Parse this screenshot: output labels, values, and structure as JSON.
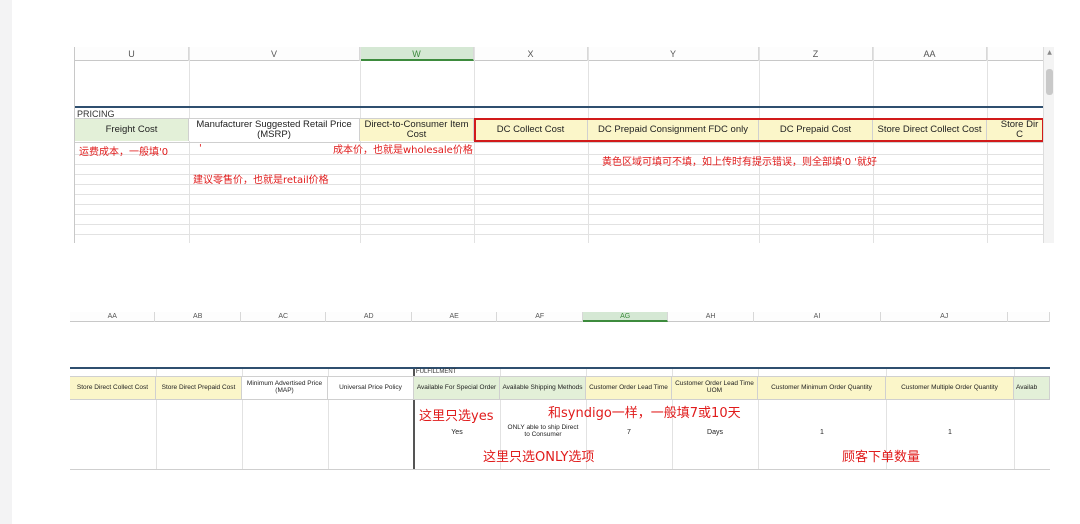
{
  "sheet_top": {
    "columns": [
      "U",
      "V",
      "W",
      "X",
      "Y",
      "Z",
      "AA"
    ],
    "selected_column": "W",
    "section_label": "PRICING",
    "headers": [
      "Freight Cost",
      "Manufacturer Suggested Retail Price (MSRP)",
      "Direct-to-Consumer Item Cost",
      "DC Collect Cost",
      "DC Prepaid Consignment FDC only",
      "DC Prepaid Cost",
      "Store Direct Collect Cost",
      "Store Dir C"
    ],
    "notes": {
      "freight": "运费成本，一般填'0",
      "tick": "'",
      "cost_price": "成本价，也就是wholesale价格",
      "yellow_area": "黄色区域可填可不填，如上传时有提示错误，则全部填'0 '就好",
      "retail": "建议零售价，也就是retail价格"
    }
  },
  "sheet_bottom": {
    "columns": [
      "AA",
      "AB",
      "AC",
      "AD",
      "AE",
      "AF",
      "AG",
      "AH",
      "AI",
      "AJ"
    ],
    "selected_column": "AG",
    "section_label": "FULFILLMENT",
    "headers": [
      "Store Direct Collect Cost",
      "Store Direct Prepaid Cost",
      "Minimum Advertised Price (MAP)",
      "Universal Price Policy",
      "Available For Special Order",
      "Available Shipping Methods",
      "Customer Order Lead Time",
      "Customer Order Lead Time UOM",
      "Customer Minimum Order Quantity",
      "Customer Multiple Order Quantity",
      "Availab"
    ],
    "values": {
      "special_order": "Yes",
      "shipping": "ONLY able to ship Direct to Consumer",
      "lead_time": "7",
      "lead_uom": "Days",
      "min_qty": "1",
      "multiple_qty": "1"
    },
    "notes": {
      "only_yes": "这里只选yes",
      "syndigo": "和syndigo一样，一般填7或10天",
      "only_option": "这里只选ONLY选项",
      "order_qty": "顾客下单数量"
    }
  }
}
